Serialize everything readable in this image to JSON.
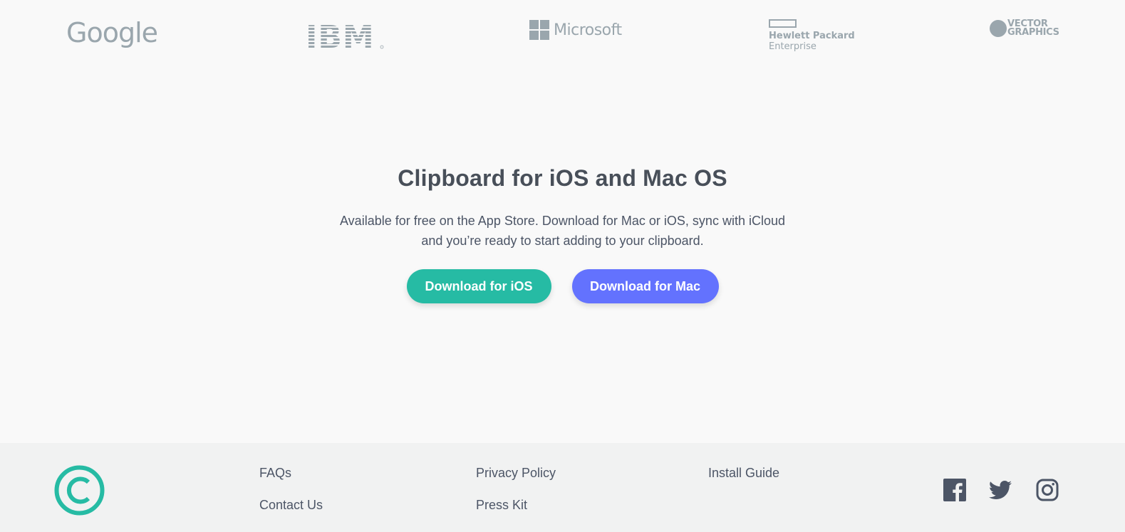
{
  "logos": {
    "google": "Google",
    "ibm": "IBM",
    "microsoft": "Microsoft",
    "hpe_line1": "Hewlett Packard",
    "hpe_line2": "Enterprise",
    "vector_line1": "VECTOR",
    "vector_line2": "GRAPHICS"
  },
  "hero": {
    "title": "Clipboard for iOS and Mac OS",
    "description": "Available for free on the App Store. Download for Mac or iOS, sync with iCloud and you’re ready to start adding to your clipboard.",
    "button_ios": "Download for iOS",
    "button_mac": "Download for Mac"
  },
  "footer": {
    "links": {
      "faqs": "FAQs",
      "contact": "Contact Us",
      "privacy": "Privacy Policy",
      "press": "Press Kit",
      "install": "Install Guide"
    },
    "social_icons": [
      "facebook-icon",
      "twitter-icon",
      "instagram-icon"
    ]
  },
  "colors": {
    "accent_teal": "#26bba4",
    "accent_blue": "#6372fe",
    "text_dark": "#484f59",
    "logo_grey": "#9aa6ad",
    "footer_bg": "#f1f2f2"
  }
}
